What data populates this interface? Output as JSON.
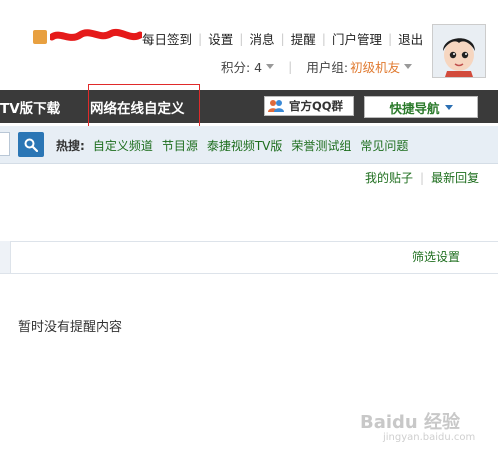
{
  "top_links": [
    "每日签到",
    "设置",
    "消息",
    "提醒",
    "门户管理",
    "退出"
  ],
  "points": {
    "label": "积分: 4",
    "group_label": "用户组:",
    "group_value": "初级机友"
  },
  "nav": {
    "tv_download": "TV版下载",
    "custom_online": "网络在线自定义",
    "qq_group": "官方QQ群",
    "quick_nav": "快捷导航"
  },
  "hot": {
    "label": "热搜:",
    "items": [
      "自定义频道",
      "节目源",
      "泰捷视频TV版",
      "荣誉测试组",
      "常见问题"
    ]
  },
  "post_links": [
    "我的贴子",
    "最新回复"
  ],
  "panel": {
    "filter": "筛选设置",
    "empty_message": "暂时没有提醒内容"
  },
  "watermark": {
    "brand": "Baidu 经验",
    "url": "jingyan.baidu.com"
  },
  "colors": {
    "nav_bg": "#3a3a3a",
    "link_green": "#1e6e1e",
    "accent_orange": "#e07a30",
    "search_blue": "#2b76b5",
    "highlight_red": "#e02a2a"
  }
}
